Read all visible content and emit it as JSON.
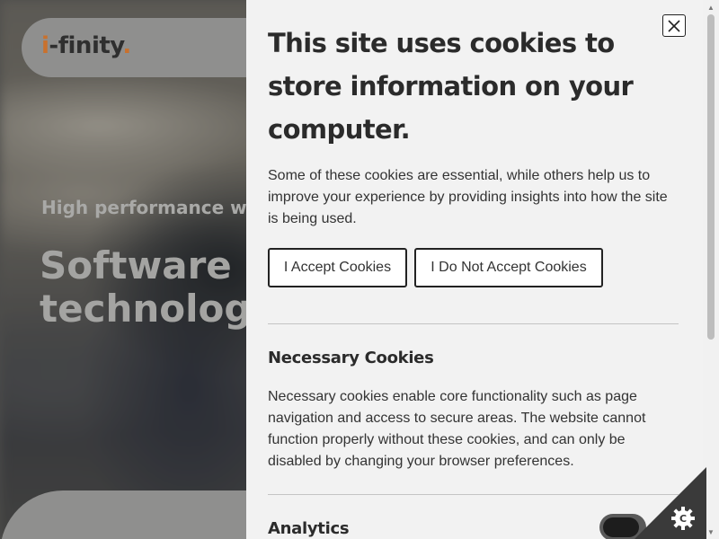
{
  "site": {
    "logo_prefix": "i",
    "logo_rest": "-finity",
    "logo_dot": ".",
    "hero_tag": "High performance web &",
    "hero_title_line1": "Software so",
    "hero_title_line2": "technology"
  },
  "cookie_panel": {
    "close_icon": "close-icon",
    "title": "This site uses cookies to store information on your computer.",
    "intro": "Some of these cookies are essential, while others help us to improve your experience by providing insights into how the site is being used.",
    "accept_label": "I Accept Cookies",
    "decline_label": "I Do Not Accept Cookies",
    "necessary": {
      "title": "Necessary Cookies",
      "text": "Necessary cookies enable core functionality such as page navigation and access to secure areas. The website cannot function properly without these cookies, and can only be disabled by changing your browser preferences."
    },
    "analytics": {
      "title": "Analytics",
      "enabled": false
    }
  },
  "colors": {
    "panel_bg": "#f2f2f2",
    "accent_orange": "#c9712d",
    "corner_badge": "#3a3a3a"
  }
}
